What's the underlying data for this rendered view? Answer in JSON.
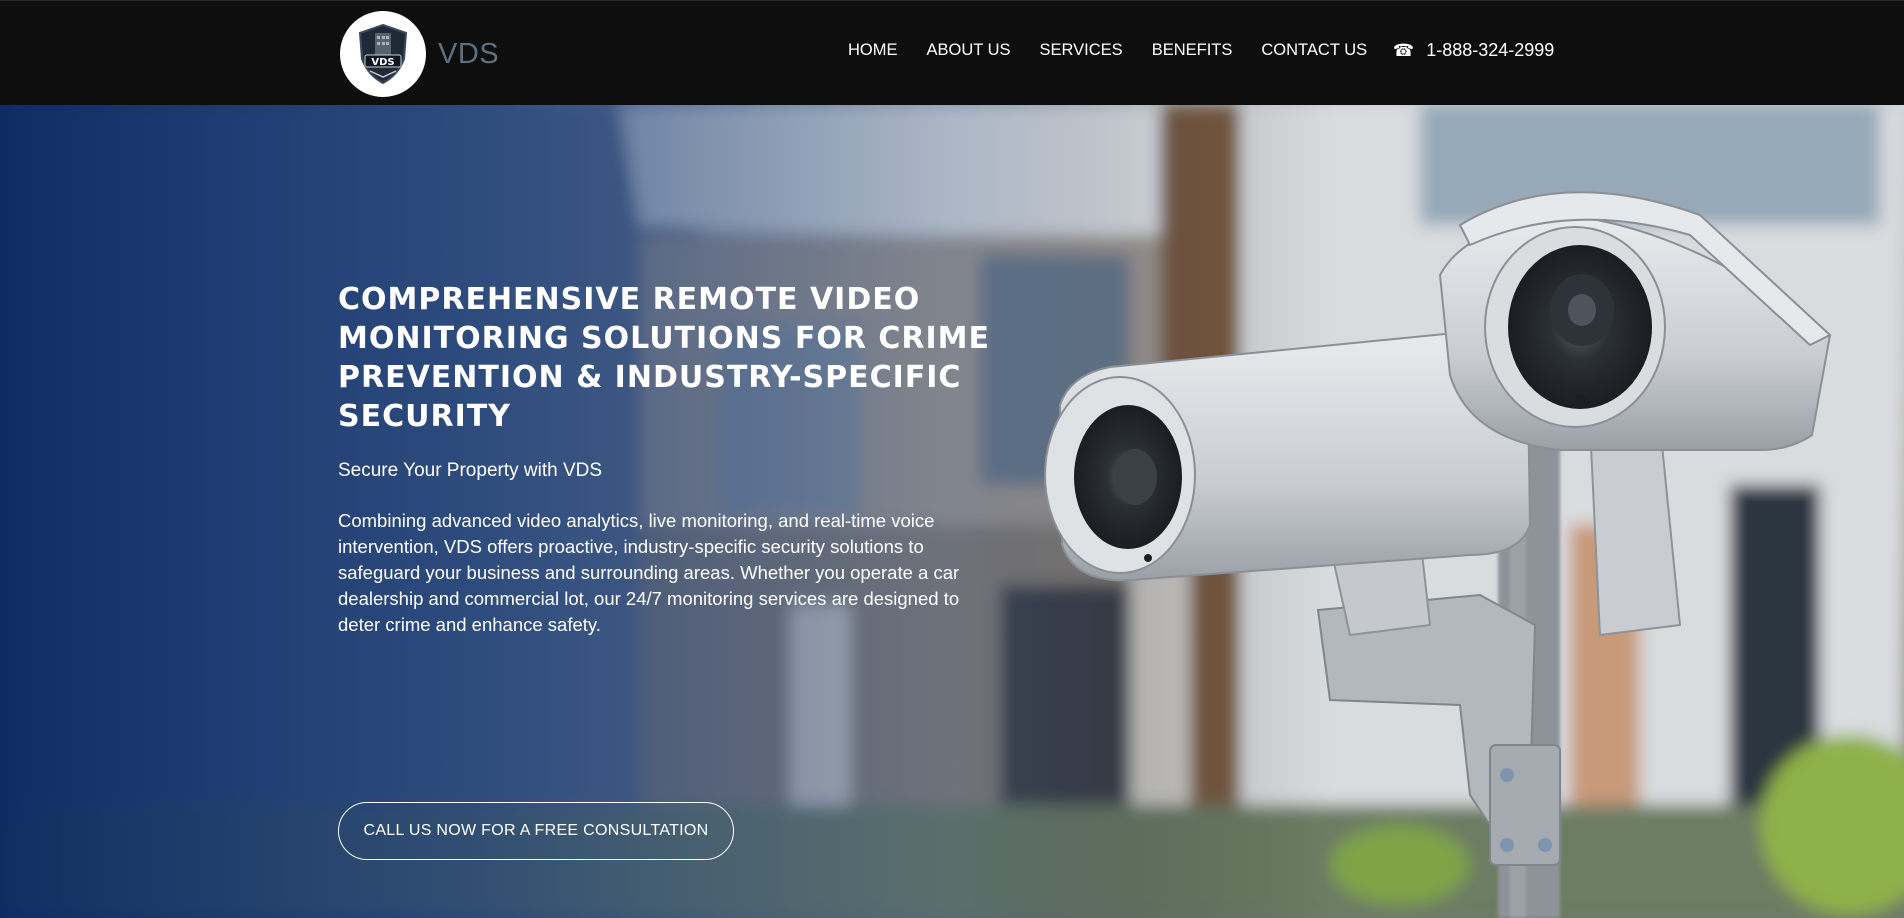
{
  "brand": {
    "name": "VDS",
    "logo_badge_text": "VDS"
  },
  "nav": {
    "items": [
      {
        "label": "HOME"
      },
      {
        "label": "ABOUT US"
      },
      {
        "label": "SERVICES"
      },
      {
        "label": "BENEFITS"
      },
      {
        "label": "CONTACT US"
      }
    ]
  },
  "contact": {
    "phone_icon": "phone-icon",
    "phone": "1-888-324-2999"
  },
  "hero": {
    "title": "COMPREHENSIVE REMOTE VIDEO MONITORING SOLUTIONS FOR CRIME PREVENTION & INDUSTRY-SPECIFIC SECURITY",
    "subtitle": "Secure Your Property with VDS",
    "body": "Combining advanced video analytics, live monitoring, and real-time voice intervention, VDS offers proactive, industry-specific security solutions to safeguard your business and surrounding areas. Whether you operate a car dealership and commercial lot, our 24/7 monitoring services are designed to deter crime and enhance safety.",
    "cta_label": "CALL US NOW FOR A FREE CONSULTATION"
  },
  "colors": {
    "header_bg": "#0e0e0e",
    "brand_text": "#5b7181",
    "hero_overlay": "#08204e",
    "text": "#ffffff"
  }
}
